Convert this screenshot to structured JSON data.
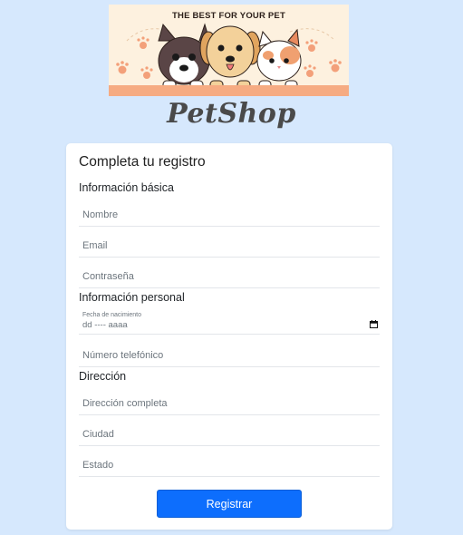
{
  "banner": {
    "caption": "THE BEST FOR YOUR PET",
    "stripe_color": "#f6ab82",
    "background_color": "#fdf1df"
  },
  "brand": {
    "name": "PetShop"
  },
  "form": {
    "title": "Completa tu registro",
    "sections": {
      "basic": "Información básica",
      "personal": "Información personal",
      "address": "Dirección"
    },
    "fields": {
      "name_placeholder": "Nombre",
      "email_placeholder": "Email",
      "password_placeholder": "Contraseña",
      "birthdate_label": "Fecha de nacimiento",
      "birthdate_value": "dd ---- aaaa",
      "phone_placeholder": "Número telefónico",
      "full_address_placeholder": "Dirección completa",
      "city_placeholder": "Ciudad",
      "state_placeholder": "Estado"
    },
    "submit_label": "Registrar"
  },
  "colors": {
    "page_background": "#d6e8fd",
    "primary": "#0d6efd"
  },
  "icons": {
    "calendar": "calendar-icon",
    "dog_left": "french-bulldog-illustration",
    "dog_center": "golden-puppy-illustration",
    "cat_right": "cat-illustration",
    "paw": "paw-print-icon"
  }
}
